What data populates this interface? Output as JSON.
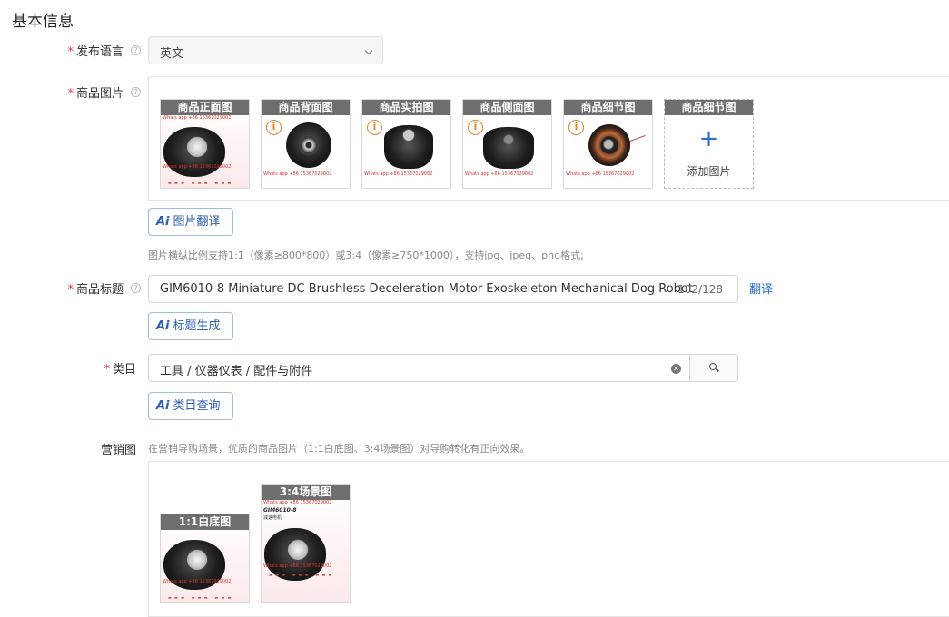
{
  "section_title": "基本信息",
  "language": {
    "label": "发布语言",
    "value": "英文"
  },
  "images": {
    "label": "商品图片",
    "items": [
      {
        "caption": "商品正面图",
        "watermark": "Whats app +86 15367029002"
      },
      {
        "caption": "商品背面图",
        "watermark": "Whats app +86 15367029002"
      },
      {
        "caption": "商品实拍图",
        "watermark": "Whats app +86 15367029002"
      },
      {
        "caption": "商品侧面图",
        "watermark": "Whats app +86 15367029002"
      },
      {
        "caption": "商品细节图",
        "watermark": "Whats app +86 15367029002"
      }
    ],
    "add_slot": {
      "caption": "商品细节图",
      "label": "添加图片"
    },
    "translate_button": "图片翻译",
    "hint": "图片横纵比例支持1:1（像素≥800*800）或3:4（像素≥750*1000），支持jpg、jpeg、png格式;"
  },
  "title": {
    "label": "商品标题",
    "value": "GIM6010-8 Miniature DC Brushless Deceleration Motor Exoskeleton Mechanical Dog Robot",
    "count": "102/128",
    "translate_link": "翻译",
    "generate_button": "标题生成"
  },
  "category": {
    "label": "类目",
    "value": "工具 / 仪器仪表 / 配件与附件",
    "query_button": "类目查询"
  },
  "marketing": {
    "label": "营销图",
    "hint": "在营销导购场景，优质的商品图片（1:1白底图、3:4场景图）对导购转化有正向效果。",
    "items": [
      {
        "caption": "1:1白底图",
        "watermark": "Whats app +86 15367029002"
      },
      {
        "caption": "3:4场景图",
        "watermark": "Whats app +86 15367029002",
        "brand": "GIM6010-8",
        "sub": "减速电机"
      }
    ]
  },
  "icons": {
    "help": "question-circle-icon",
    "warning": "warning-circle-icon",
    "plus": "plus-icon",
    "clear": "clear-circle-icon",
    "search": "search-icon",
    "chevron": "chevron-down-icon",
    "ai": "ai-sparkle-icon"
  },
  "colors": {
    "required": "#e4393c",
    "link": "#2b6bd0",
    "caption_bg": "#6e6e6e",
    "warning": "#e8832a"
  }
}
